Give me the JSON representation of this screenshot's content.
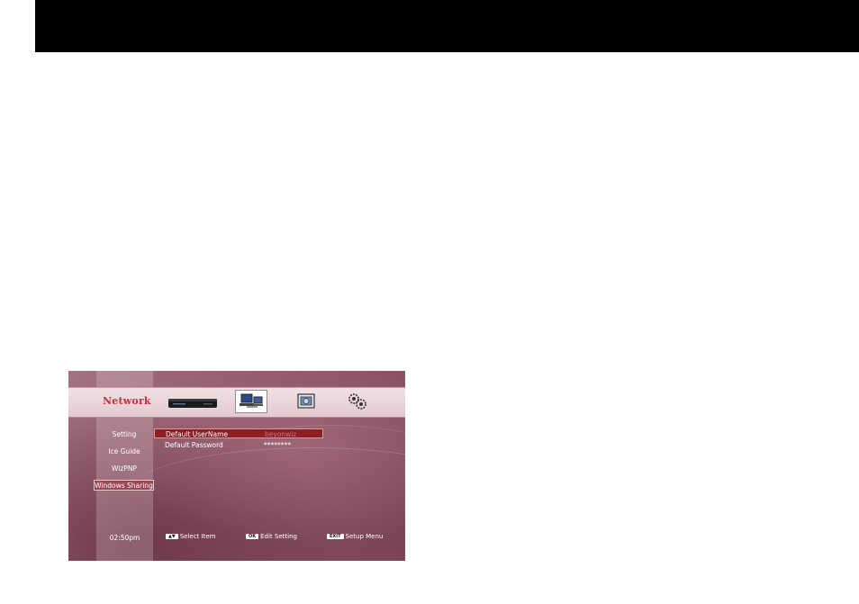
{
  "header": {
    "title": "Network"
  },
  "tabs": [
    {
      "icon": "media-player-device-icon"
    },
    {
      "icon": "network-computers-icon",
      "selected": true
    },
    {
      "icon": "media-library-icon"
    },
    {
      "icon": "gears-icon"
    }
  ],
  "sidebar": {
    "items": [
      {
        "label": "Setting"
      },
      {
        "label": "Ice Guide"
      },
      {
        "label": "WizPNP"
      },
      {
        "label": "Windows Sharing",
        "selected": true
      }
    ]
  },
  "settings": {
    "rows": [
      {
        "label": "Default UserName",
        "value": "beyonwiz",
        "selected": true
      },
      {
        "label": "Default Password",
        "value": "********"
      }
    ]
  },
  "footer": {
    "time": "02:50pm",
    "hints": [
      {
        "key": "▲▼",
        "label": "Select Item"
      },
      {
        "key": "OK",
        "label": "Edit Setting"
      },
      {
        "key": "EXIT",
        "label": "Setup Menu"
      }
    ]
  }
}
